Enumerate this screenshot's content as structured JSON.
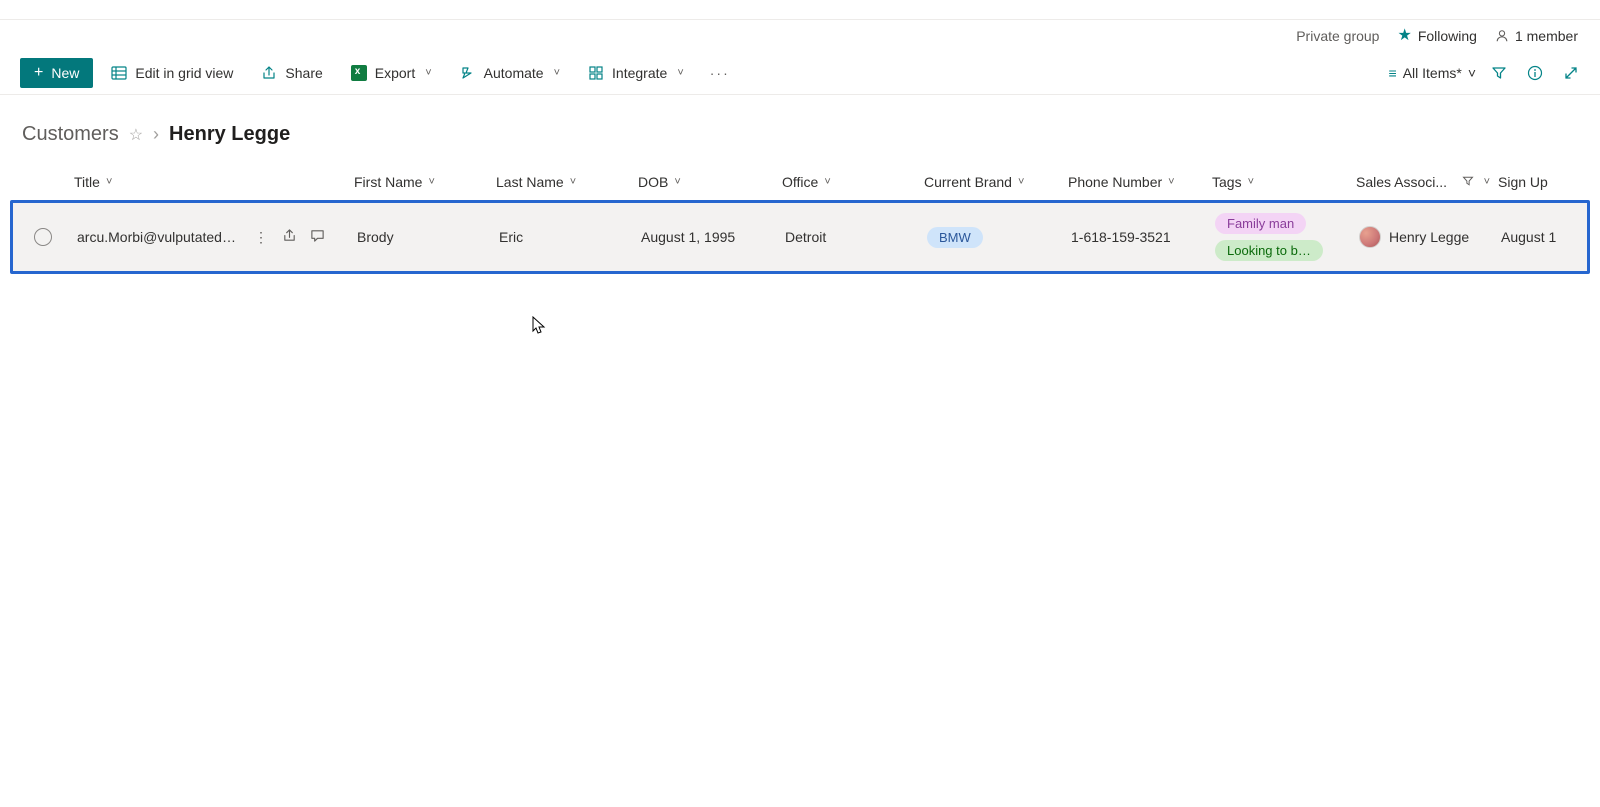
{
  "header": {
    "group_type": "Private group",
    "following_label": "Following",
    "members_label": "1 member"
  },
  "commands": {
    "new_label": "New",
    "edit_grid_label": "Edit in grid view",
    "share_label": "Share",
    "export_label": "Export",
    "automate_label": "Automate",
    "integrate_label": "Integrate",
    "view_label": "All Items*"
  },
  "breadcrumb": {
    "root": "Customers",
    "current": "Henry Legge"
  },
  "columns": {
    "title": "Title",
    "first_name": "First Name",
    "last_name": "Last Name",
    "dob": "DOB",
    "office": "Office",
    "current_brand": "Current Brand",
    "phone": "Phone Number",
    "tags": "Tags",
    "sales_assoc": "Sales Associ...",
    "sign_up": "Sign Up"
  },
  "row": {
    "title": "arcu.Morbi@vulputatedui...",
    "first_name": "Brody",
    "last_name": "Eric",
    "dob": "August 1, 1995",
    "office": "Detroit",
    "brand": "BMW",
    "phone": "1-618-159-3521",
    "tag1": "Family man",
    "tag2": "Looking to buy s...",
    "sales_assoc_name": "Henry Legge",
    "sign_up": "August 1"
  }
}
